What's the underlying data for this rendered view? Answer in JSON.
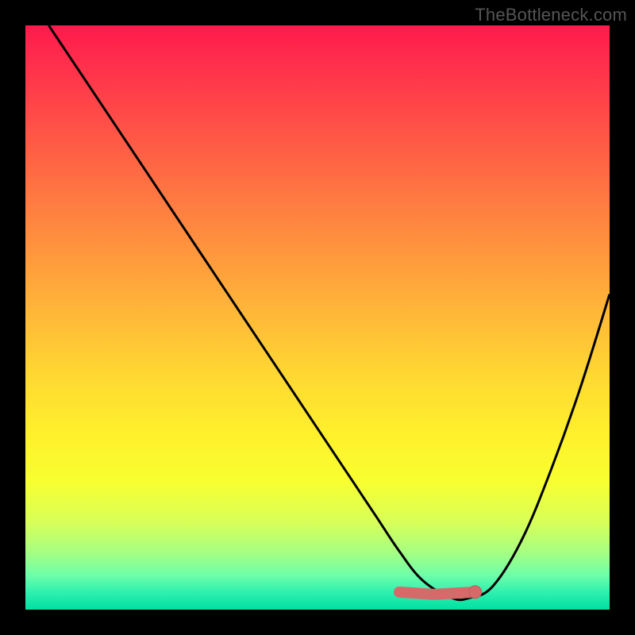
{
  "watermark": "TheBottleneck.com",
  "chart_data": {
    "type": "line",
    "title": "",
    "xlabel": "",
    "ylabel": "",
    "xlim": [
      0,
      100
    ],
    "ylim": [
      0,
      100
    ],
    "grid": false,
    "legend": false,
    "series": [
      {
        "name": "bottleneck-curve",
        "x": [
          4,
          10,
          20,
          30,
          40,
          50,
          56,
          60,
          64,
          68,
          73,
          76,
          80,
          85,
          90,
          95,
          100
        ],
        "y": [
          100,
          91,
          76,
          61,
          46,
          31,
          22,
          16,
          10,
          5,
          2,
          2,
          4,
          12,
          24,
          38,
          54
        ]
      }
    ],
    "markers": [
      {
        "name": "flat-region-start",
        "x": 64,
        "y": 3.0
      },
      {
        "name": "flat-region-mid",
        "x": 70,
        "y": 2.6
      },
      {
        "name": "flat-region-end",
        "x": 77,
        "y": 3.0
      }
    ],
    "gradient_stops": [
      {
        "pos": 0,
        "color": "#ff1a4d"
      },
      {
        "pos": 50,
        "color": "#ffba38"
      },
      {
        "pos": 78,
        "color": "#f8ff30"
      },
      {
        "pos": 100,
        "color": "#00e0a0"
      }
    ],
    "colors": {
      "curve": "#000000",
      "marker_fill": "#d66a6a",
      "marker_stroke": "#c05a5a",
      "background_frame": "#000000"
    }
  }
}
